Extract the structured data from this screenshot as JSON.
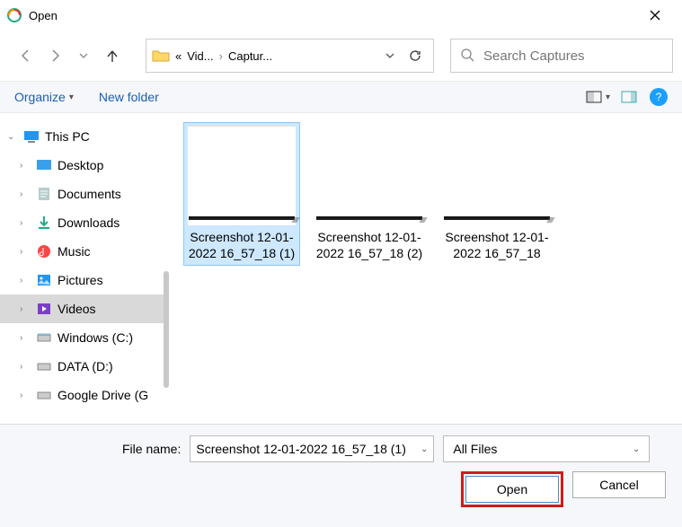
{
  "window": {
    "title": "Open"
  },
  "breadcrumbs": {
    "root_ellipsis": "«",
    "seg1": "Vid...",
    "seg2": "Captur..."
  },
  "search": {
    "placeholder": "Search Captures"
  },
  "toolbar": {
    "organize": "Organize",
    "new_folder": "New folder"
  },
  "tree": {
    "root": "This PC",
    "items": [
      {
        "label": "Desktop"
      },
      {
        "label": "Documents"
      },
      {
        "label": "Downloads"
      },
      {
        "label": "Music"
      },
      {
        "label": "Pictures"
      },
      {
        "label": "Videos"
      },
      {
        "label": "Windows (C:)"
      },
      {
        "label": "DATA (D:)"
      },
      {
        "label": "Google Drive (G"
      }
    ]
  },
  "files": [
    {
      "name": "Screenshot 12-01-2022 16_57_18 (1)",
      "selected": true
    },
    {
      "name": "Screenshot 12-01-2022 16_57_18 (2)",
      "selected": false
    },
    {
      "name": "Screenshot 12-01-2022 16_57_18",
      "selected": false
    }
  ],
  "footer": {
    "file_name_label": "File name:",
    "file_name_value": "Screenshot 12-01-2022 16_57_18 (1)",
    "filter": "All Files",
    "open": "Open",
    "cancel": "Cancel"
  }
}
